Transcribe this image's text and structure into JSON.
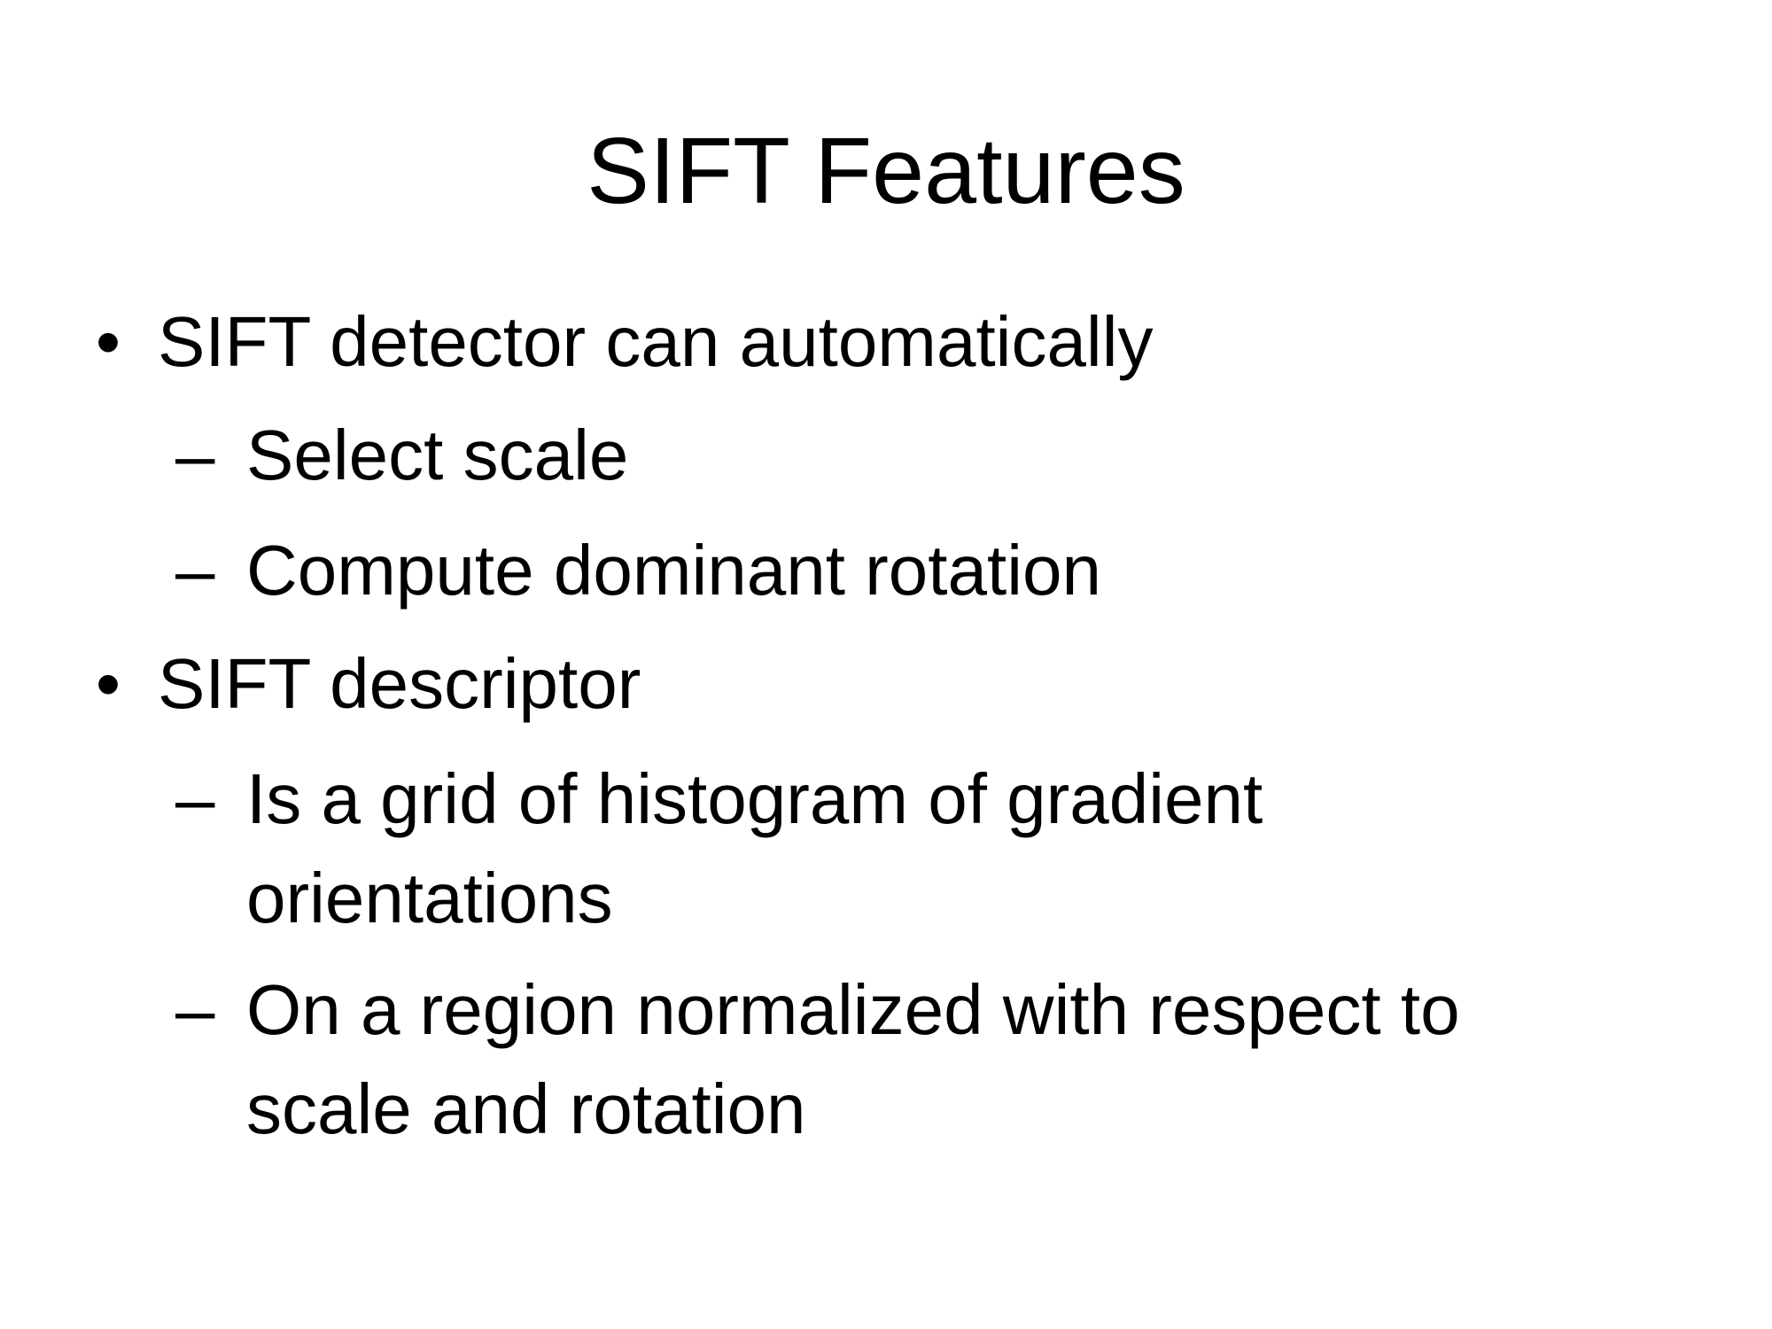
{
  "slide": {
    "title": "SIFT Features",
    "bullets": [
      {
        "marker": "•",
        "text": "SIFT detector can automatically"
      },
      {
        "marker": "–",
        "text": "Select scale"
      },
      {
        "marker": "–",
        "text": "Compute dominant rotation"
      },
      {
        "marker": "•",
        "text": "SIFT descriptor"
      },
      {
        "marker": "–",
        "text": "Is a grid of histogram of gradient orientations"
      },
      {
        "marker": "–",
        "text": "On a region normalized with respect to scale and rotation"
      }
    ]
  }
}
